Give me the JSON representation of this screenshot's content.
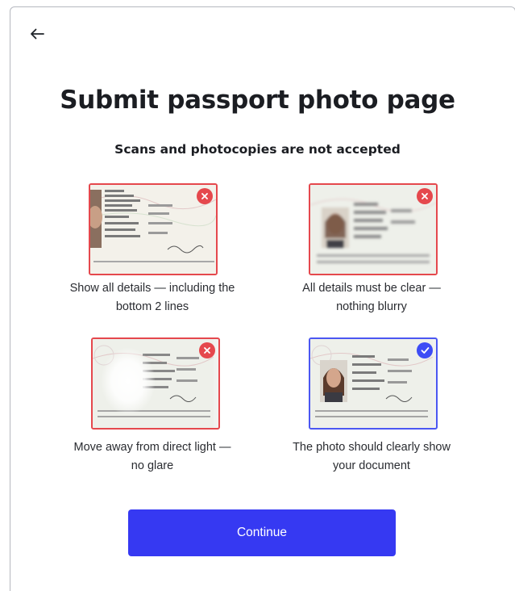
{
  "header": {
    "back_icon": "arrow-left-icon",
    "title": "Submit passport photo page",
    "subtitle": "Scans and photocopies are not accepted"
  },
  "examples": [
    {
      "caption_line1": "Show all details — including the",
      "caption_line2": "bottom 2 lines",
      "status": "invalid",
      "status_icon": "x-circle-icon"
    },
    {
      "caption_line1": "All details must be clear —",
      "caption_line2": "nothing blurry",
      "status": "invalid",
      "status_icon": "x-circle-icon"
    },
    {
      "caption_line1": "Move away from direct light —",
      "caption_line2": "no glare",
      "status": "invalid",
      "status_icon": "x-circle-icon"
    },
    {
      "caption_line1": "The photo should clearly show",
      "caption_line2": "your document",
      "status": "valid",
      "status_icon": "check-circle-icon"
    }
  ],
  "actions": {
    "continue_label": "Continue"
  },
  "colors": {
    "primary": "#3639f2",
    "invalid": "#e5484d",
    "valid": "#4b57f2",
    "text": "#1b1d22"
  }
}
